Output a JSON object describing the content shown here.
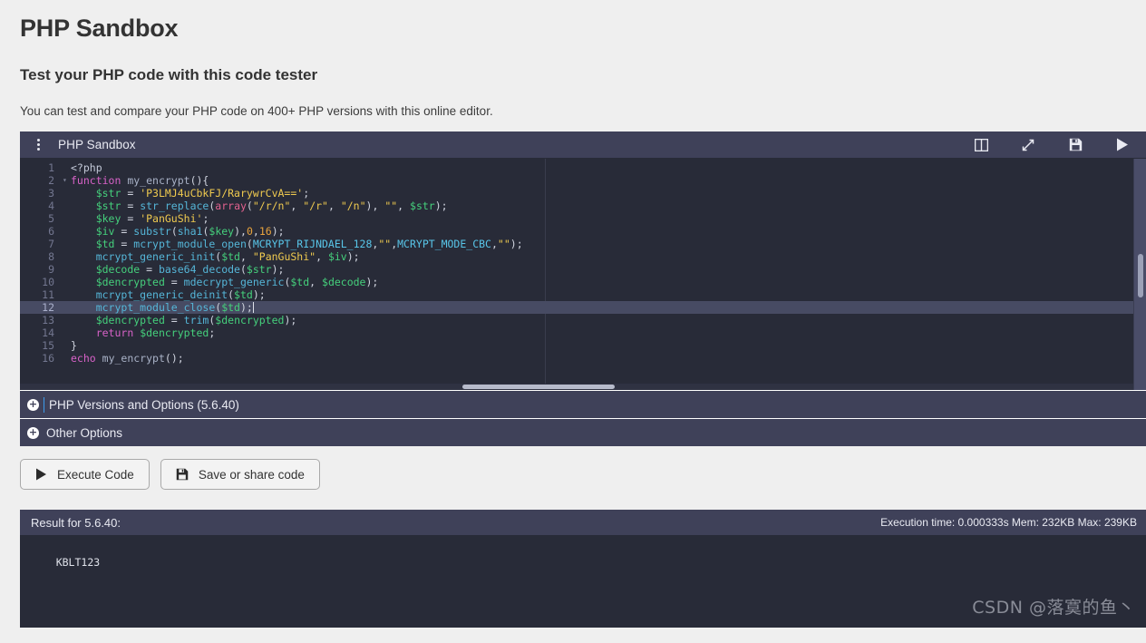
{
  "page": {
    "title": "PHP Sandbox",
    "subtitle": "Test your PHP code with this code tester",
    "lede": "You can test and compare your PHP code on 400+ PHP versions with this online editor."
  },
  "editor": {
    "name": "PHP Sandbox",
    "menu_icon": "kebab-menu-icon",
    "toolbar": [
      {
        "icon": "split-view-icon",
        "label": "Split view"
      },
      {
        "icon": "expand-icon",
        "label": "Fullscreen"
      },
      {
        "icon": "save-icon",
        "label": "Save"
      },
      {
        "icon": "run-icon",
        "label": "Run"
      }
    ],
    "active_line": 12,
    "lines": [
      {
        "n": 1,
        "fold": false,
        "indent": 0,
        "tokens": [
          {
            "t": "tag",
            "v": "<?php"
          }
        ]
      },
      {
        "n": 2,
        "fold": true,
        "indent": 0,
        "tokens": [
          {
            "t": "kw",
            "v": "function"
          },
          {
            "t": "plain",
            "v": " "
          },
          {
            "t": "fn",
            "v": "my_encrypt"
          },
          {
            "t": "punc",
            "v": "(){"
          }
        ]
      },
      {
        "n": 3,
        "fold": false,
        "indent": 1,
        "tokens": [
          {
            "t": "var",
            "v": "$str"
          },
          {
            "t": "punc",
            "v": " = "
          },
          {
            "t": "str",
            "v": "'P3LMJ4uCbkFJ/RarywrCvA=='"
          },
          {
            "t": "punc",
            "v": ";"
          }
        ]
      },
      {
        "n": 4,
        "fold": false,
        "indent": 1,
        "tokens": [
          {
            "t": "var",
            "v": "$str"
          },
          {
            "t": "punc",
            "v": " = "
          },
          {
            "t": "call",
            "v": "str_replace"
          },
          {
            "t": "punc",
            "v": "("
          },
          {
            "t": "arr",
            "v": "array"
          },
          {
            "t": "punc",
            "v": "("
          },
          {
            "t": "str",
            "v": "\"/r/n\""
          },
          {
            "t": "punc",
            "v": ", "
          },
          {
            "t": "str",
            "v": "\"/r\""
          },
          {
            "t": "punc",
            "v": ", "
          },
          {
            "t": "str",
            "v": "\"/n\""
          },
          {
            "t": "punc",
            "v": "), "
          },
          {
            "t": "str",
            "v": "\"\""
          },
          {
            "t": "punc",
            "v": ", "
          },
          {
            "t": "var",
            "v": "$str"
          },
          {
            "t": "punc",
            "v": ");"
          }
        ]
      },
      {
        "n": 5,
        "fold": false,
        "indent": 1,
        "tokens": [
          {
            "t": "var",
            "v": "$key"
          },
          {
            "t": "punc",
            "v": " = "
          },
          {
            "t": "str",
            "v": "'PanGuShi'"
          },
          {
            "t": "punc",
            "v": ";"
          }
        ]
      },
      {
        "n": 6,
        "fold": false,
        "indent": 1,
        "tokens": [
          {
            "t": "var",
            "v": "$iv"
          },
          {
            "t": "punc",
            "v": " = "
          },
          {
            "t": "call",
            "v": "substr"
          },
          {
            "t": "punc",
            "v": "("
          },
          {
            "t": "call",
            "v": "sha1"
          },
          {
            "t": "punc",
            "v": "("
          },
          {
            "t": "var",
            "v": "$key"
          },
          {
            "t": "punc",
            "v": "),"
          },
          {
            "t": "num",
            "v": "0"
          },
          {
            "t": "punc",
            "v": ","
          },
          {
            "t": "num",
            "v": "16"
          },
          {
            "t": "punc",
            "v": ");"
          }
        ]
      },
      {
        "n": 7,
        "fold": false,
        "indent": 1,
        "tokens": [
          {
            "t": "var",
            "v": "$td"
          },
          {
            "t": "punc",
            "v": " = "
          },
          {
            "t": "call",
            "v": "mcrypt_module_open"
          },
          {
            "t": "punc",
            "v": "("
          },
          {
            "t": "const",
            "v": "MCRYPT_RIJNDAEL_128"
          },
          {
            "t": "punc",
            "v": ","
          },
          {
            "t": "str",
            "v": "\"\""
          },
          {
            "t": "punc",
            "v": ","
          },
          {
            "t": "const",
            "v": "MCRYPT_MODE_CBC"
          },
          {
            "t": "punc",
            "v": ","
          },
          {
            "t": "str",
            "v": "\"\""
          },
          {
            "t": "punc",
            "v": ");"
          }
        ]
      },
      {
        "n": 8,
        "fold": false,
        "indent": 1,
        "tokens": [
          {
            "t": "call",
            "v": "mcrypt_generic_init"
          },
          {
            "t": "punc",
            "v": "("
          },
          {
            "t": "var",
            "v": "$td"
          },
          {
            "t": "punc",
            "v": ", "
          },
          {
            "t": "str",
            "v": "\"PanGuShi\""
          },
          {
            "t": "punc",
            "v": ", "
          },
          {
            "t": "var",
            "v": "$iv"
          },
          {
            "t": "punc",
            "v": ");"
          }
        ]
      },
      {
        "n": 9,
        "fold": false,
        "indent": 1,
        "tokens": [
          {
            "t": "var",
            "v": "$decode"
          },
          {
            "t": "punc",
            "v": " = "
          },
          {
            "t": "call",
            "v": "base64_decode"
          },
          {
            "t": "punc",
            "v": "("
          },
          {
            "t": "var",
            "v": "$str"
          },
          {
            "t": "punc",
            "v": ");"
          }
        ]
      },
      {
        "n": 10,
        "fold": false,
        "indent": 1,
        "tokens": [
          {
            "t": "var",
            "v": "$dencrypted"
          },
          {
            "t": "punc",
            "v": " = "
          },
          {
            "t": "call",
            "v": "mdecrypt_generic"
          },
          {
            "t": "punc",
            "v": "("
          },
          {
            "t": "var",
            "v": "$td"
          },
          {
            "t": "punc",
            "v": ", "
          },
          {
            "t": "var",
            "v": "$decode"
          },
          {
            "t": "punc",
            "v": ");"
          }
        ]
      },
      {
        "n": 11,
        "fold": false,
        "indent": 1,
        "tokens": [
          {
            "t": "call",
            "v": "mcrypt_generic_deinit"
          },
          {
            "t": "punc",
            "v": "("
          },
          {
            "t": "var",
            "v": "$td"
          },
          {
            "t": "punc",
            "v": ");"
          }
        ]
      },
      {
        "n": 12,
        "fold": false,
        "indent": 1,
        "tokens": [
          {
            "t": "call",
            "v": "mcrypt_module_close"
          },
          {
            "t": "punc",
            "v": "("
          },
          {
            "t": "var",
            "v": "$td"
          },
          {
            "t": "punc",
            "v": ");"
          }
        ]
      },
      {
        "n": 13,
        "fold": false,
        "indent": 1,
        "tokens": [
          {
            "t": "var",
            "v": "$dencrypted"
          },
          {
            "t": "punc",
            "v": " = "
          },
          {
            "t": "call",
            "v": "trim"
          },
          {
            "t": "punc",
            "v": "("
          },
          {
            "t": "var",
            "v": "$dencrypted"
          },
          {
            "t": "punc",
            "v": ");"
          }
        ]
      },
      {
        "n": 14,
        "fold": false,
        "indent": 1,
        "tokens": [
          {
            "t": "kw",
            "v": "return"
          },
          {
            "t": "plain",
            "v": " "
          },
          {
            "t": "var",
            "v": "$dencrypted"
          },
          {
            "t": "punc",
            "v": ";"
          }
        ]
      },
      {
        "n": 15,
        "fold": false,
        "indent": 0,
        "tokens": [
          {
            "t": "punc",
            "v": "}"
          }
        ]
      },
      {
        "n": 16,
        "fold": false,
        "indent": 0,
        "tokens": [
          {
            "t": "kw",
            "v": "echo"
          },
          {
            "t": "plain",
            "v": " "
          },
          {
            "t": "fn",
            "v": "my_encrypt"
          },
          {
            "t": "punc",
            "v": "();"
          }
        ]
      }
    ]
  },
  "panels": [
    {
      "label": "PHP Versions and Options (5.6.40)",
      "icon": "plus-circle-icon",
      "has_caret": true
    },
    {
      "label": "Other Options",
      "icon": "plus-circle-icon",
      "has_caret": false
    }
  ],
  "actions": [
    {
      "label": "Execute Code",
      "icon": "run-icon"
    },
    {
      "label": "Save or share code",
      "icon": "save-icon"
    }
  ],
  "result": {
    "header": "Result for 5.6.40:",
    "meta": "Execution time: 0.000333s Mem: 232KB Max: 239KB",
    "output": "KBLT123",
    "watermark": "CSDN @落寞的鱼丶"
  },
  "colors": {
    "page_bg": "#efefef",
    "panel_bg": "#3f4159",
    "editor_bg": "#282b38",
    "active_line": "#474b63",
    "accent_caret": "#3c9bea"
  }
}
